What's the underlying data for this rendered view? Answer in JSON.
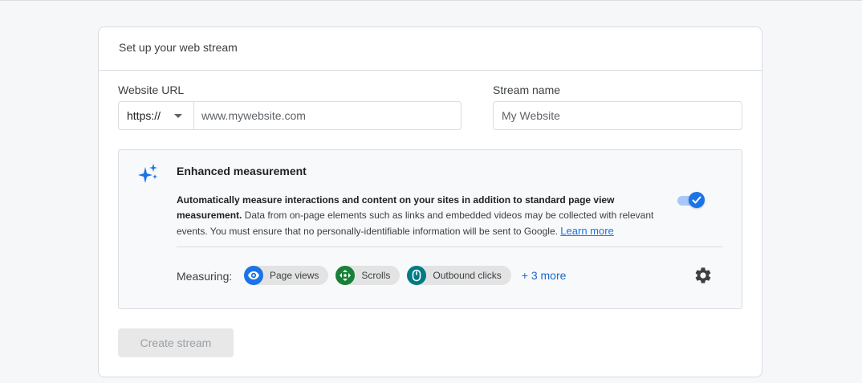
{
  "card": {
    "title": "Set up your web stream"
  },
  "website_url": {
    "label": "Website URL",
    "protocol": "https://",
    "placeholder": "www.mywebsite.com",
    "value": ""
  },
  "stream_name": {
    "label": "Stream name",
    "placeholder": "My Website",
    "value": ""
  },
  "enhanced_measurement": {
    "title": "Enhanced measurement",
    "description_bold": "Automatically measure interactions and content on your sites in addition to standard page view measurement.",
    "description": "Data from on-page elements such as links and embedded videos may be collected with relevant events. You must ensure that no personally-identifiable information will be sent to Google.",
    "learn_more": "Learn more",
    "enabled": true,
    "measuring_label": "Measuring:",
    "chips": [
      {
        "label": "Page views",
        "icon": "eye-icon",
        "color": "#1a73e8"
      },
      {
        "label": "Scrolls",
        "icon": "scroll-arrows-icon",
        "color": "#188038"
      },
      {
        "label": "Outbound clicks",
        "icon": "mouse-icon",
        "color": "#007b83"
      }
    ],
    "more_link": "+ 3 more"
  },
  "create_button": {
    "label": "Create stream",
    "disabled": true
  },
  "colors": {
    "accent": "#1a73e8",
    "link": "#1967d2",
    "border": "#dadce0",
    "background": "#f6f7f9"
  }
}
